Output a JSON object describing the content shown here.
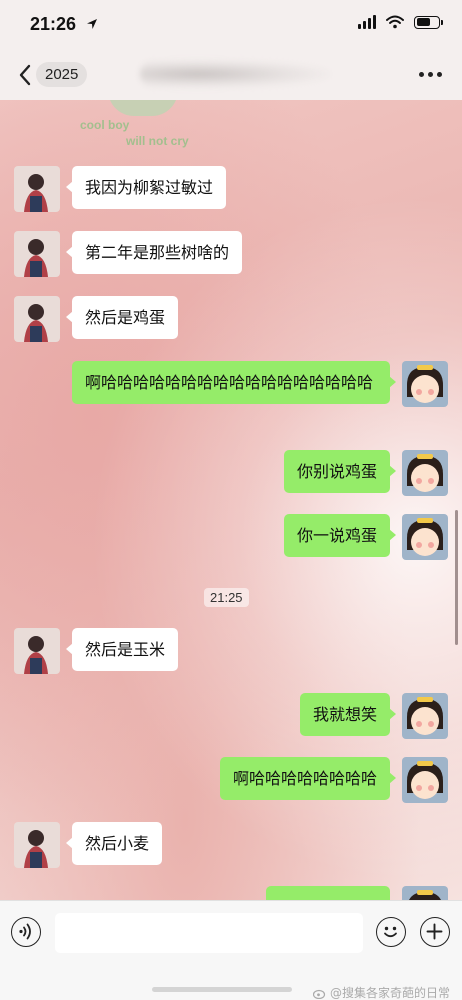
{
  "status_bar": {
    "time": "21:26"
  },
  "nav": {
    "title": "2025"
  },
  "wallpaper": {
    "line1": "cool boy",
    "line2": "will not cry"
  },
  "messages": [
    {
      "side": "left",
      "text": "我因为柳絮过敏过"
    },
    {
      "side": "left",
      "text": "第二年是那些树啥的"
    },
    {
      "side": "left",
      "text": "然后是鸡蛋"
    },
    {
      "side": "right",
      "text": "啊哈哈哈哈哈哈哈哈哈哈哈哈哈哈哈哈哈"
    },
    {
      "side": "right",
      "text": "你别说鸡蛋"
    },
    {
      "side": "right",
      "text": "你一说鸡蛋"
    },
    {
      "side": "left",
      "text": "然后是玉米"
    },
    {
      "side": "right",
      "text": "我就想笑"
    },
    {
      "side": "right",
      "text": "啊哈哈哈哈哈哈哈哈"
    },
    {
      "side": "left",
      "text": "然后小麦"
    }
  ],
  "timestamp": "21:25",
  "input": {
    "placeholder": ""
  },
  "watermark": "@搜集各家奇葩的日常",
  "colors": {
    "my_bubble": "#95ec69",
    "their_bubble": "#ffffff"
  }
}
